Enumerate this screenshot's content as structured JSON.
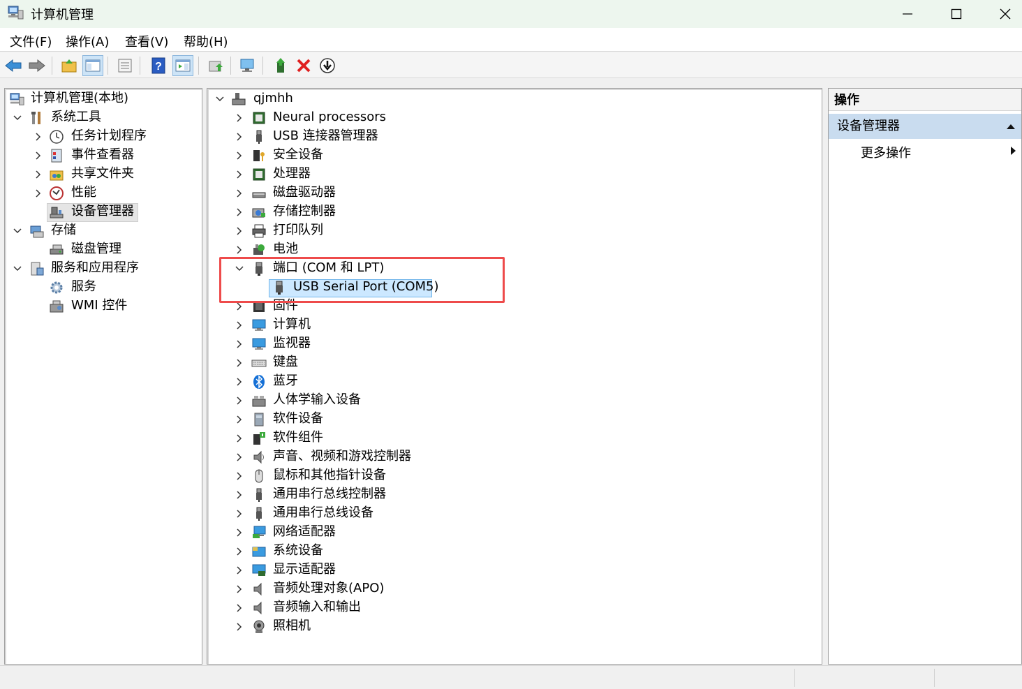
{
  "window": {
    "title": "计算机管理"
  },
  "menu": [
    "文件(F)",
    "操作(A)",
    "查看(V)",
    "帮助(H)"
  ],
  "left_tree": {
    "root": "计算机管理(本地)",
    "system_tools": "系统工具",
    "task_scheduler": "任务计划程序",
    "event_viewer": "事件查看器",
    "shared_folders": "共享文件夹",
    "performance": "性能",
    "device_manager": "设备管理器",
    "storage": "存储",
    "disk_management": "磁盘管理",
    "services_apps": "服务和应用程序",
    "services": "服务",
    "wmi": "WMI 控件"
  },
  "device_tree": {
    "root": "qjmhh",
    "categories": [
      "Neural processors",
      "USB 连接器管理器",
      "安全设备",
      "处理器",
      "磁盘驱动器",
      "存储控制器",
      "打印队列",
      "电池",
      "端口 (COM 和 LPT)",
      "固件",
      "计算机",
      "监视器",
      "键盘",
      "蓝牙",
      "人体学输入设备",
      "软件设备",
      "软件组件",
      "声音、视频和游戏控制器",
      "鼠标和其他指针设备",
      "通用串行总线控制器",
      "通用串行总线设备",
      "网络适配器",
      "系统设备",
      "显示适配器",
      "音频处理对象(APO)",
      "音频输入和输出",
      "照相机"
    ],
    "selected_child": "USB Serial Port (COM5)"
  },
  "actions": {
    "header": "操作",
    "group": "设备管理器",
    "more": "更多操作"
  }
}
